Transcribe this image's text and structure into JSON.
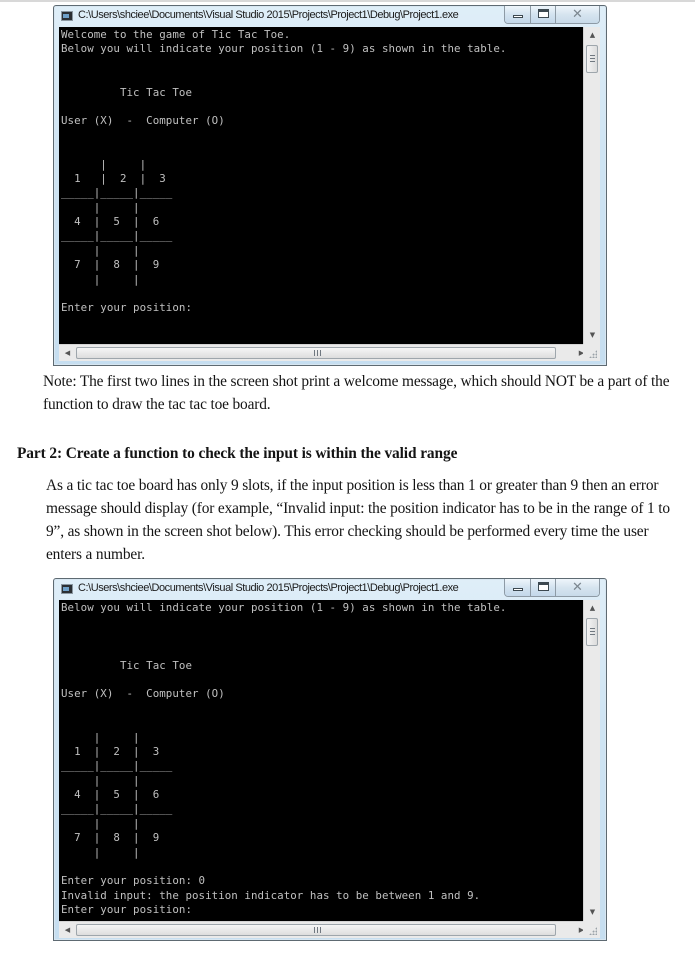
{
  "windows": [
    {
      "title": "C:\\Users\\shciee\\Documents\\Visual Studio 2015\\Projects\\Project1\\Debug\\Project1.exe",
      "console_lines": [
        "Welcome to the game of Tic Tac Toe.",
        "Below you will indicate your position (1 - 9) as shown in the table.",
        "",
        "",
        "         Tic Tac Toe",
        "",
        "User (X)  -  Computer (O)",
        "",
        "",
        "      |     |",
        "  1   |  2  |  3",
        "_____|_____|_____",
        "     |     |",
        "  4  |  5  |  6",
        "_____|_____|_____",
        "     |     |",
        "  7  |  8  |  9",
        "     |     |",
        "",
        "Enter your position:"
      ]
    },
    {
      "title": "C:\\Users\\shciee\\Documents\\Visual Studio 2015\\Projects\\Project1\\Debug\\Project1.exe",
      "console_lines": [
        "Below you will indicate your position (1 - 9) as shown in the table.",
        "",
        "",
        "",
        "         Tic Tac Toe",
        "",
        "User (X)  -  Computer (O)",
        "",
        "",
        "     |     |",
        "  1  |  2  |  3",
        "_____|_____|_____",
        "     |     |",
        "  4  |  5  |  6",
        "_____|_____|_____",
        "     |     |",
        "  7  |  8  |  9",
        "     |     |",
        "",
        "Enter your position: 0",
        "Invalid input: the position indicator has to be between 1 and 9.",
        "Enter your position:"
      ]
    }
  ],
  "icons": {
    "close": "✕",
    "scroll_up": "▲",
    "scroll_down": "▼",
    "scroll_left": "◀",
    "scroll_right": "▶"
  },
  "document": {
    "note": "Note: The first two lines in the screen shot print a welcome message, which should NOT be a part of the function to draw the tac tac toe board.",
    "part2_heading": "Part 2: Create a function to check the input is within the valid range",
    "part2_body": "As a tic tac toe board has only 9 slots, if the input position is less than 1 or greater than 9 then an error message should display (for example, “Invalid input: the position indicator has to be in the range of 1 to 9”, as shown in the screen shot below). This error checking should be performed every time the user enters a number."
  }
}
